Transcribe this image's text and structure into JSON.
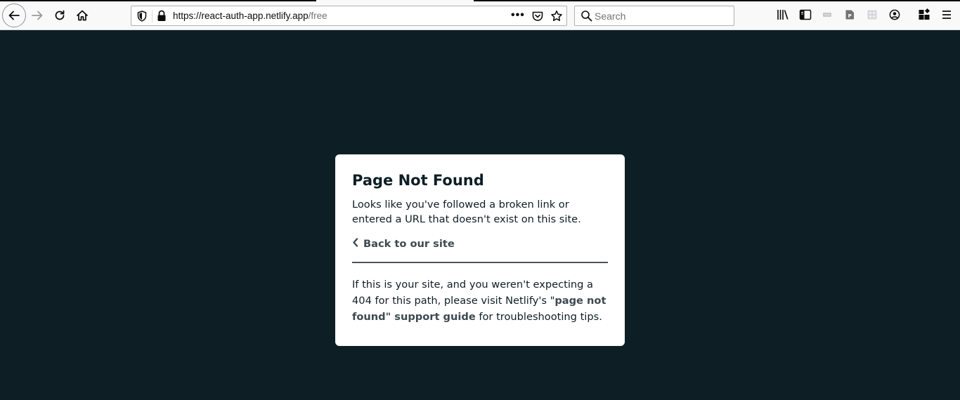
{
  "browser": {
    "url_host": "https://react-auth-app.netlify.app",
    "url_path": "/free",
    "more_label": "•••",
    "search_placeholder": "Search"
  },
  "page": {
    "title": "Page Not Found",
    "description": "Looks like you've followed a broken link or entered a URL that doesn't exist on this site.",
    "back_link": "Back to our site",
    "help_before": "If this is your site, and you weren't expecting a 404 for this path, please visit Netlify's \"",
    "help_link": "page not found\" support guide",
    "help_after": " for troubleshooting tips."
  },
  "colors": {
    "background": "#0e1e25",
    "card": "#ffffff",
    "text": "#0e1e25",
    "link": "#3d4a50"
  }
}
